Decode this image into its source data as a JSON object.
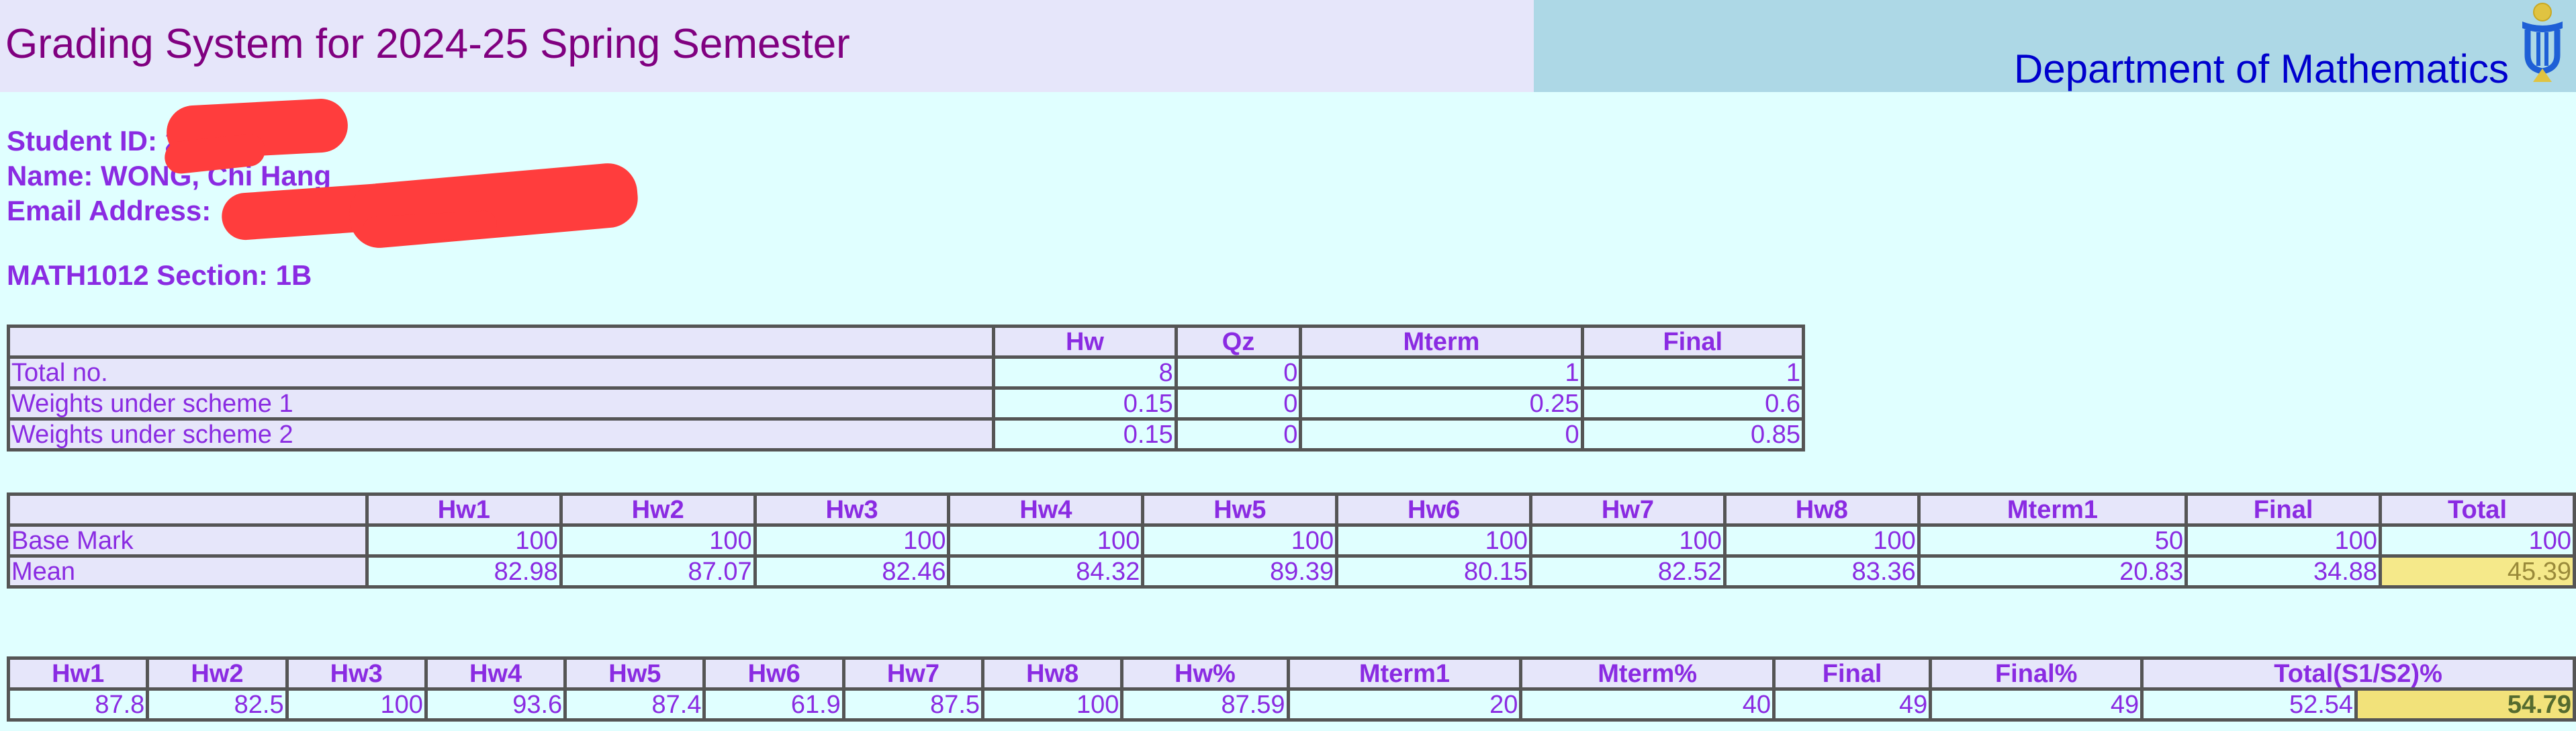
{
  "header": {
    "title": "Grading System for 2024-25 Spring Semester",
    "department": "Department of Mathematics",
    "logo_icon": "university-logo-icon"
  },
  "student": {
    "id_label": "Student ID: 2",
    "name_label": "Name: WONG, Chi Hang",
    "email_label": "Email Address:",
    "section_label": "MATH1012 Section: 1B"
  },
  "weights_table": {
    "headers": [
      "",
      "Hw",
      "Qz",
      "Mterm",
      "Final"
    ],
    "rows": [
      {
        "label": "Total no.",
        "values": [
          "8",
          "0",
          "1",
          "1"
        ]
      },
      {
        "label": "Weights under scheme 1",
        "values": [
          "0.15",
          "0",
          "0.25",
          "0.6"
        ]
      },
      {
        "label": "Weights under scheme 2",
        "values": [
          "0.15",
          "0",
          "0",
          "0.85"
        ]
      }
    ]
  },
  "stats_table": {
    "headers": [
      "",
      "Hw1",
      "Hw2",
      "Hw3",
      "Hw4",
      "Hw5",
      "Hw6",
      "Hw7",
      "Hw8",
      "Mterm1",
      "Final",
      "Total"
    ],
    "rows": [
      {
        "label": "Base Mark",
        "values": [
          "100",
          "100",
          "100",
          "100",
          "100",
          "100",
          "100",
          "100",
          "50",
          "100",
          "100"
        ]
      },
      {
        "label": "Mean",
        "values": [
          "82.98",
          "87.07",
          "82.46",
          "84.32",
          "89.39",
          "80.15",
          "82.52",
          "83.36",
          "20.83",
          "34.88",
          "45.39"
        ]
      }
    ]
  },
  "scores_table": {
    "headers": [
      "Hw1",
      "Hw2",
      "Hw3",
      "Hw4",
      "Hw5",
      "Hw6",
      "Hw7",
      "Hw8",
      "Hw%",
      "Mterm1",
      "Mterm%",
      "Final",
      "Final%",
      "Total(S1/S2)%"
    ],
    "values": [
      "87.8",
      "82.5",
      "100",
      "93.6",
      "87.4",
      "61.9",
      "87.5",
      "100",
      "87.59",
      "20",
      "40",
      "49",
      "49",
      "52.54",
      "54.79"
    ]
  },
  "colors": {
    "page_bg": "#e0ffff",
    "header_left_bg": "#e6e6fa",
    "header_right_bg": "#add8e6",
    "title_color": "#800080",
    "dept_color": "#0000cd",
    "text_color": "#8a2be2",
    "redaction": "#ff3d3d",
    "highlight": "#f5e98a"
  }
}
